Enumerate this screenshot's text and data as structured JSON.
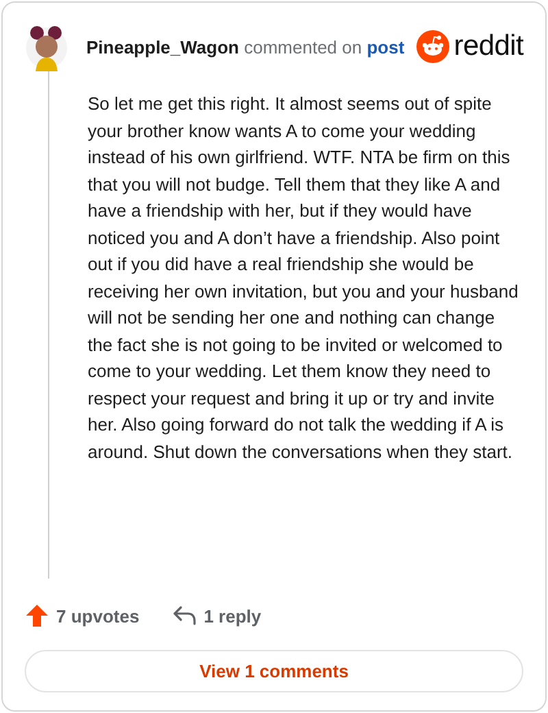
{
  "comment": {
    "author": "Pineapple_Wagon",
    "action": "commented on",
    "link": "post",
    "body": "So let me get this right. It almost seems out of spite your brother know wants A to come your wedding instead of his own girlfriend. WTF. NTA be firm on this that you will not budge. Tell them that they like A and have a friendship with her, but if they would have noticed you and A don’t have a friendship. Also point out if you did have a real friendship she would be receiving her own invitation, but you and your husband will not be sending her one and nothing can change the fact she is not going to be invited or welcomed to come to your wedding. Let them know they need to respect your request and bring it up or try and invite her. Also going forward do not talk the wedding if A is around. Shut down the conversations when they start.",
    "upvotes": "7 upvotes",
    "replies": "1 reply"
  },
  "brand": "reddit",
  "view_button": "View 1 comments"
}
